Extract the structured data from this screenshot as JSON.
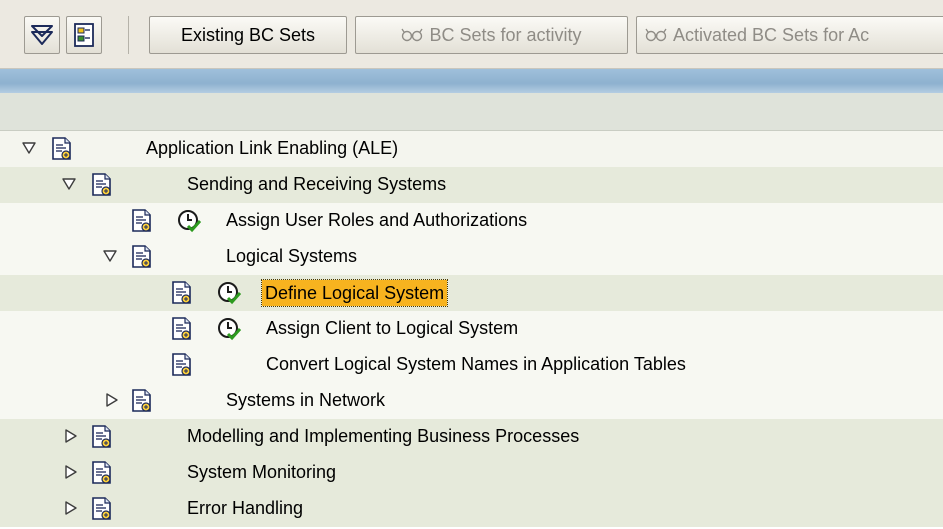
{
  "toolbar": {
    "existing_bc_sets": "Existing BC Sets",
    "bc_sets_for_activity": "BC Sets for activity",
    "activated_bc_sets": "Activated BC Sets for Ac"
  },
  "tree": {
    "ale": "Application Link Enabling (ALE)",
    "sending_receiving": "Sending and Receiving Systems",
    "assign_user_roles": "Assign User Roles and Authorizations",
    "logical_systems": "Logical Systems",
    "define_logical_system": "Define Logical System",
    "assign_client": "Assign Client to Logical System",
    "convert_names": "Convert Logical System Names in Application Tables",
    "systems_in_network": "Systems in Network",
    "modelling": "Modelling and Implementing Business Processes",
    "system_monitoring": "System Monitoring",
    "error_handling": "Error Handling"
  },
  "colors": {
    "selected_bg": "#f7b31f",
    "blue_band": "#8eb1cf",
    "toolbar_bg": "#ece9e1"
  }
}
